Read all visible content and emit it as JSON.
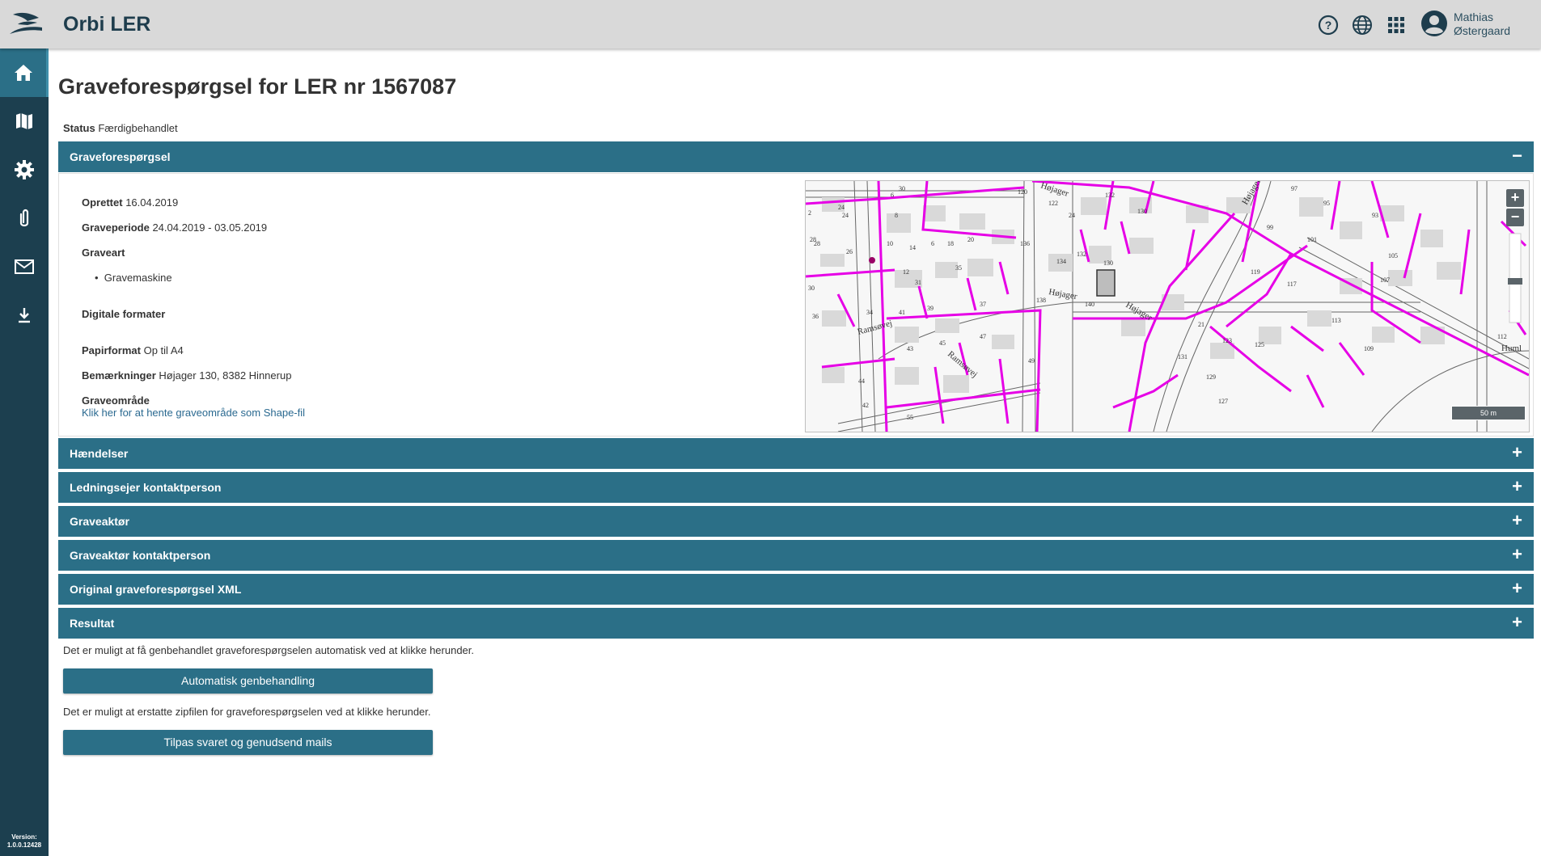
{
  "app": {
    "title": "Orbi LER"
  },
  "user": {
    "first_name": "Mathias",
    "last_name": "Østergaard"
  },
  "topbar_icons": [
    "help-icon",
    "globe-icon",
    "apps-grid-icon",
    "account-icon"
  ],
  "sidebar": {
    "items": [
      {
        "icon": "home-icon",
        "active": true
      },
      {
        "icon": "map-icon",
        "active": false
      },
      {
        "icon": "gear-icon",
        "active": false
      },
      {
        "icon": "paperclip-icon",
        "active": false
      },
      {
        "icon": "mail-icon",
        "active": false
      },
      {
        "icon": "download-icon",
        "active": false
      }
    ],
    "version_label": "Version:",
    "version_number": "1.0.0.12428"
  },
  "page": {
    "title": "Graveforespørgsel for LER nr 1567087",
    "status_label": "Status",
    "status_value": "Færdigbehandlet"
  },
  "details": {
    "header": "Graveforespørgsel",
    "sign": "−",
    "created_label": "Oprettet",
    "created_value": "16.04.2019",
    "period_label": "Graveperiode",
    "period_value": "24.04.2019 - 03.05.2019",
    "type_label": "Graveart",
    "type_items": [
      "Gravemaskine"
    ],
    "digital_label": "Digitale formater",
    "paper_label": "Papirformat",
    "paper_value": "Op til A4",
    "remarks_label": "Bemærkninger",
    "remarks_value": "Højager 130, 8382 Hinnerup",
    "area_label": "Graveområde",
    "area_link": "Klik her for at hente graveområde som Shape-fil"
  },
  "map": {
    "zoom_in": "+",
    "zoom_out": "−",
    "scale": "50 m",
    "street_labels": [
      "Højager",
      "Højager",
      "Højager",
      "Ramsøvej",
      "Ramsøvej",
      "Højager",
      "Huml"
    ],
    "house_numbers": [
      "120",
      "122",
      "24",
      "132",
      "130",
      "97",
      "95",
      "93",
      "99",
      "101",
      "105",
      "107",
      "28",
      "26",
      "24",
      "18",
      "14",
      "6",
      "20",
      "35",
      "30",
      "136",
      "134",
      "132",
      "130",
      "140",
      "138",
      "41",
      "39",
      "37",
      "45",
      "43",
      "47",
      "49",
      "55",
      "36",
      "34",
      "44",
      "42",
      "31",
      "21",
      "123",
      "125",
      "129",
      "131",
      "127",
      "109",
      "113",
      "117",
      "119",
      "28",
      "2",
      "30",
      "24",
      "12",
      "6",
      "8",
      "10",
      "112"
    ]
  },
  "sections": [
    {
      "title": "Hændelser",
      "sign": "+"
    },
    {
      "title": "Ledningsejer kontaktperson",
      "sign": "+"
    },
    {
      "title": "Graveaktør",
      "sign": "+"
    },
    {
      "title": "Graveaktør kontaktperson",
      "sign": "+"
    },
    {
      "title": "Original graveforespørgsel XML",
      "sign": "+"
    },
    {
      "title": "Resultat",
      "sign": "+"
    }
  ],
  "actions": {
    "info1": "Det er muligt at få genbehandlet graveforespørgselen automatisk ved at klikke herunder.",
    "button1": "Automatisk genbehandling",
    "info2": "Det er muligt at erstatte zipfilen for graveforespørgselen ved at klikke herunder.",
    "button2": "Tilpas svaret og genudsend mails"
  },
  "colors": {
    "topbar": "#d9d9d9",
    "sidebar": "#1c3f4f",
    "accent": "#2b6f87",
    "utility_lines": "#e600e6"
  }
}
